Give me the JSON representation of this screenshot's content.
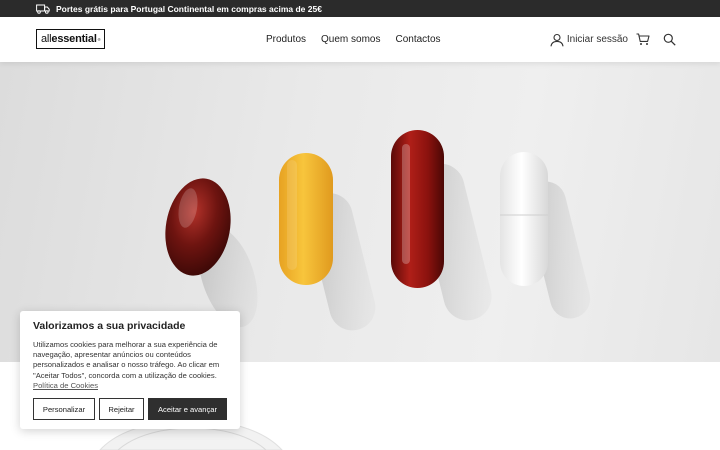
{
  "announcement": {
    "text": "Portes grátis para Portugal Continental em compras acima de 25€"
  },
  "logo": {
    "text_light": "all",
    "text_bold": "essential",
    "mark": "®"
  },
  "nav": {
    "items": [
      "Produtos",
      "Quem somos",
      "Contactos"
    ]
  },
  "header_actions": {
    "login_label": "Iniciar sessão"
  },
  "cookie_banner": {
    "title": "Valorizamos a sua privacidade",
    "body": "Utilizamos cookies para melhorar a sua experiência de navegação, apresentar anúncios ou conteúdos personalizados e analisar o nosso tráfego. Ao clicar em \"Aceitar Todos\", concorda com a utilização de cookies.",
    "policy_link": "Política de Cookies",
    "buttons": {
      "customize": "Personalizar",
      "reject": "Rejeitar",
      "accept": "Aceitar e avançar"
    }
  },
  "icons": [
    "truck-icon",
    "user-icon",
    "cart-icon",
    "search-icon"
  ]
}
